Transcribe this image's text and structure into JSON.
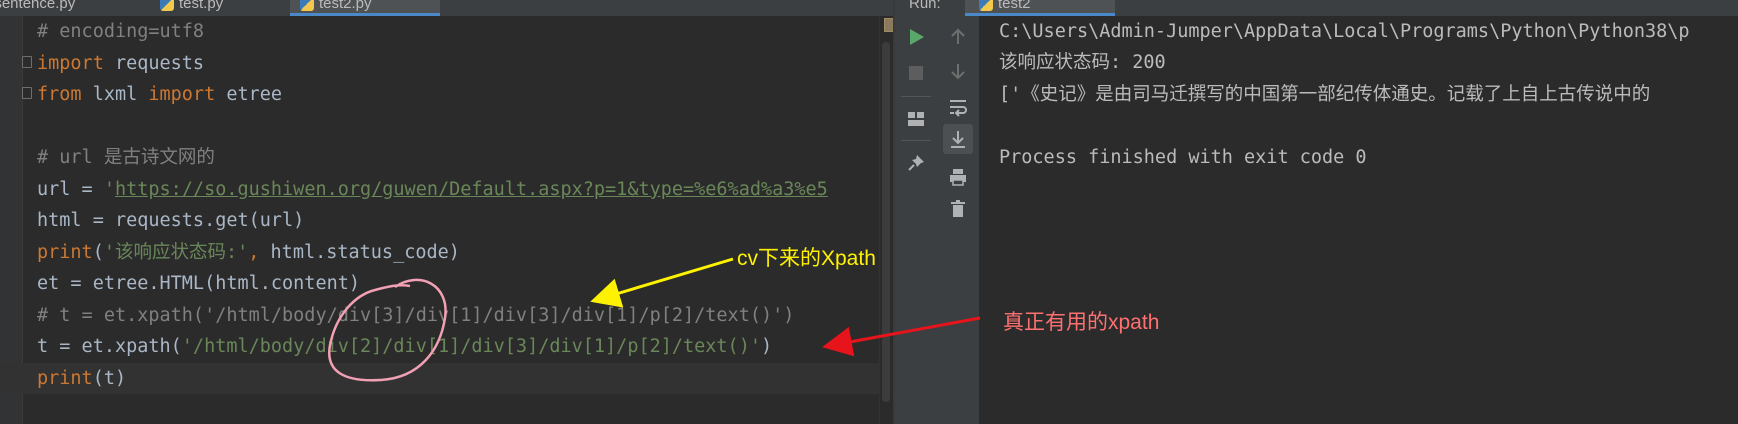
{
  "editor": {
    "tabs": [
      {
        "label": "_sentence.py"
      },
      {
        "label": "test.py"
      },
      {
        "label": "test2.py"
      }
    ],
    "code_lines": [
      {
        "spans": [
          {
            "t": "# encoding=utf8",
            "c": "c"
          }
        ]
      },
      {
        "spans": [
          {
            "t": "import",
            "c": "k"
          },
          {
            "t": " requests",
            "c": ""
          }
        ]
      },
      {
        "spans": [
          {
            "t": "from",
            "c": "k"
          },
          {
            "t": " lxml ",
            "c": ""
          },
          {
            "t": "import",
            "c": "k"
          },
          {
            "t": " etree",
            "c": ""
          }
        ]
      },
      {
        "spans": []
      },
      {
        "spans": [
          {
            "t": "# url 是古诗文网的",
            "c": "c"
          }
        ]
      },
      {
        "spans": [
          {
            "t": "url = ",
            "c": ""
          },
          {
            "t": "'",
            "c": "s"
          },
          {
            "t": "https://so.gushiwen.org/guwen/Default.aspx?p=1&type=%e6%ad%a3%e5",
            "c": "u"
          }
        ]
      },
      {
        "spans": [
          {
            "t": "html = requests.get(url)",
            "c": ""
          }
        ]
      },
      {
        "spans": [
          {
            "t": "print",
            "c": "k"
          },
          {
            "t": "(",
            "c": ""
          },
          {
            "t": "'该响应状态码:'",
            "c": "s"
          },
          {
            "t": ", ",
            "c": "k"
          },
          {
            "t": "html.status_code)",
            "c": ""
          }
        ]
      },
      {
        "spans": [
          {
            "t": "et = etree.HTML(html.content)",
            "c": ""
          }
        ]
      },
      {
        "spans": [
          {
            "t": "# t = et.xpath('/html/body/div[3]/div[1]/div[3]/div[1]/p[2]/text()')",
            "c": "c"
          }
        ]
      },
      {
        "spans": [
          {
            "t": "t = et.xpath(",
            "c": ""
          },
          {
            "t": "'/html/body/div[2]/div[1]/div[3]/div[1]/p[2]/text()'",
            "c": "s"
          },
          {
            "t": ")",
            "c": ""
          }
        ]
      },
      {
        "spans": [
          {
            "t": "print",
            "c": "k"
          },
          {
            "t": "(t)",
            "c": ""
          }
        ]
      }
    ]
  },
  "run": {
    "tabs": [
      {
        "label": "Run:"
      },
      {
        "label": "test2"
      }
    ],
    "tools_left": [
      {
        "icon": "run-icon"
      },
      {
        "icon": "stop-icon"
      },
      {
        "icon": "layout-icon"
      },
      {
        "icon": "pin-icon"
      }
    ],
    "tools_right": [
      {
        "icon": "arrow-up-icon"
      },
      {
        "icon": "arrow-down-icon"
      },
      {
        "icon": "soft-wrap-icon"
      },
      {
        "icon": "scroll-to-end-icon"
      },
      {
        "icon": "print-icon"
      },
      {
        "icon": "trash-icon"
      }
    ],
    "console_lines": [
      "C:\\Users\\Admin-Jumper\\AppData\\Local\\Programs\\Python\\Python38\\p",
      "该响应状态码: 200",
      "['《史记》是由司马迁撰写的中国第一部纪传体通史。记载了上自上古传说中的",
      "",
      "Process finished with exit code 0"
    ]
  },
  "annotations": {
    "yellow_note": "cv下来的Xpath",
    "red_note": "真正有用的xpath",
    "colors": {
      "yellow": "#fff200",
      "red": "#e8141c",
      "circle": "#f2a0b4",
      "red_text": "#ff7070"
    }
  },
  "colors": {
    "editor_bg": "#2b2b2b",
    "panel_bg": "#3c3f41",
    "keyword": "#cc7832",
    "string": "#6a8759",
    "comment": "#808080",
    "text": "#a9b7c6",
    "run_green": "#59a869"
  }
}
